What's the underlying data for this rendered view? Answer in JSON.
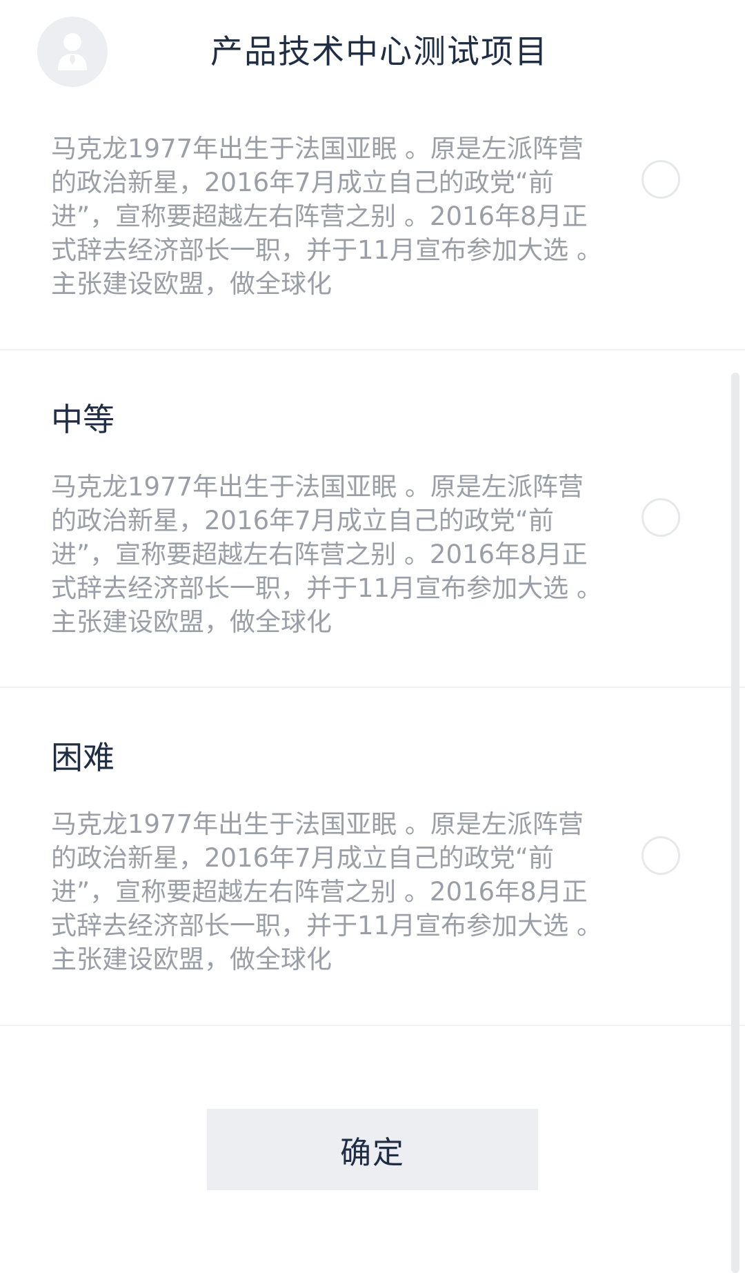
{
  "header": {
    "avatar_icon": "user-avatar-icon",
    "title": "产品技术中心测试项目"
  },
  "options": [
    {
      "label": "",
      "description": "马克龙1977年出生于法国亚眠 。原是左派阵营的政治新星，2016年7月成立自己的政党“前进”，宣称要超越左右阵营之别 。2016年8月正式辞去经济部长一职，并于11月宣布参加大选 。主张建设欧盟，做全球化",
      "selected": false
    },
    {
      "label": "中等",
      "description": "马克龙1977年出生于法国亚眠 。原是左派阵营的政治新星，2016年7月成立自己的政党“前进”，宣称要超越左右阵营之别 。2016年8月正式辞去经济部长一职，并于11月宣布参加大选 。主张建设欧盟，做全球化",
      "selected": false
    },
    {
      "label": "困难",
      "description": "马克龙1977年出生于法国亚眠 。原是左派阵营的政治新星，2016年7月成立自己的政党“前进”，宣称要超越左右阵营之别 。2016年8月正式辞去经济部长一职，并于11月宣布参加大选 。主张建设欧盟，做全球化",
      "selected": false
    }
  ],
  "confirm_label": "确定",
  "colors": {
    "title": "#1f2d45",
    "description": "#9a9ea6",
    "button_bg": "#eceef1"
  }
}
